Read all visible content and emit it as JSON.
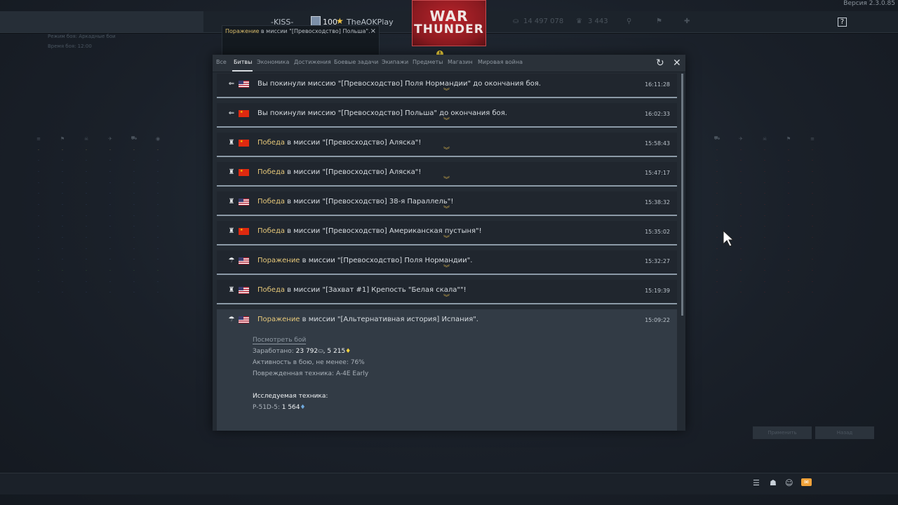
{
  "version": "Версия 2.3.0.85",
  "topbar": {
    "clan": "-KISS-",
    "level": "100",
    "nickname": "TheAOKPlay",
    "silver_lions": "14 497 078",
    "golden_eagles": "3 443",
    "help": "?"
  },
  "logo": {
    "line1": "WAR",
    "line2": "THUNDER"
  },
  "notification": {
    "result": "Поражение",
    "text": " в миссии \"[Превосходство] Польша\".",
    "close": "×"
  },
  "warning": "!",
  "tabs": [
    {
      "label": "Все",
      "active": false
    },
    {
      "label": "Битвы",
      "active": true
    },
    {
      "label": "Экономика",
      "active": false
    },
    {
      "label": "Достижения",
      "active": false
    },
    {
      "label": "Боевые задачи",
      "active": false
    },
    {
      "label": "Экипажи",
      "active": false
    },
    {
      "label": "Предметы",
      "active": false
    },
    {
      "label": "Магазин",
      "active": false
    },
    {
      "label": "Мировая война",
      "active": false
    }
  ],
  "panel": {
    "refresh": "↻",
    "close": "✕"
  },
  "entries": [
    {
      "icon": "exit-arrow-icon",
      "flag": "us",
      "result": "",
      "text": "Вы покинули миссию \"[Превосходство] Поля Нормандии\" до окончания боя.",
      "time": "16:11:28"
    },
    {
      "icon": "exit-arrow-icon",
      "flag": "cn",
      "result": "",
      "text": "Вы покинули миссию \"[Превосходство] Польша\" до окончания боя.",
      "time": "16:02:33"
    },
    {
      "icon": "trophy-icon",
      "flag": "cn",
      "result": "Победа",
      "text": " в миссии \"[Превосходство] Аляска\"!",
      "time": "15:58:43"
    },
    {
      "icon": "trophy-icon",
      "flag": "cn",
      "result": "Победа",
      "text": " в миссии \"[Превосходство] Аляска\"!",
      "time": "15:47:17"
    },
    {
      "icon": "trophy-icon",
      "flag": "us",
      "result": "Победа",
      "text": " в миссии \"[Превосходство] 38-я Параллель\"!",
      "time": "15:38:32"
    },
    {
      "icon": "trophy-icon",
      "flag": "cn",
      "result": "Победа",
      "text": " в миссии \"[Превосходство] Американская пустыня\"!",
      "time": "15:35:02"
    },
    {
      "icon": "parachute-icon",
      "flag": "us",
      "result": "Поражение",
      "text": " в миссии \"[Превосходство] Поля Нормандии\".",
      "time": "15:32:27"
    },
    {
      "icon": "trophy-icon",
      "flag": "us",
      "result": "Победа",
      "text": " в миссии \"[Захват #1] Крепость \"Белая скала\"\"!",
      "time": "15:19:39"
    }
  ],
  "expanded": {
    "flag": "us",
    "result": "Поражение",
    "text": " в миссии \"[Альтернативная история] Испания\".",
    "time": "15:09:22",
    "view_battle": "Посмотреть бой",
    "earned_label": "Заработано: ",
    "earned_lions": "23 792",
    "earned_rp": "5 215",
    "activity": "Активность в бою, не менее: 76%",
    "damaged": "Поврежденная техника: A-4E Early",
    "research_title": "Исследуемая техника:",
    "research_vehicle": "P-51D-5: ",
    "research_value": "1 564"
  },
  "background": {
    "left_info_1": "Режим боя: Аркадные бои",
    "left_info_2": "Время боя: 12:00",
    "left_table_headers": [
      "≡",
      "⚑",
      "☠",
      "✈",
      "⛟",
      "◉"
    ],
    "right_table_headers": [
      "⛟",
      "✈",
      "☠",
      "⚑",
      "≡"
    ],
    "buttons": [
      "Применить",
      "Назад"
    ]
  },
  "bottombar": {
    "list": "☰",
    "squad": "☗",
    "chat": "☺",
    "mail": "✉"
  },
  "colors": {
    "result": "#e5c779",
    "accent_logo": "#b8242b",
    "mail": "#f0a23a"
  }
}
